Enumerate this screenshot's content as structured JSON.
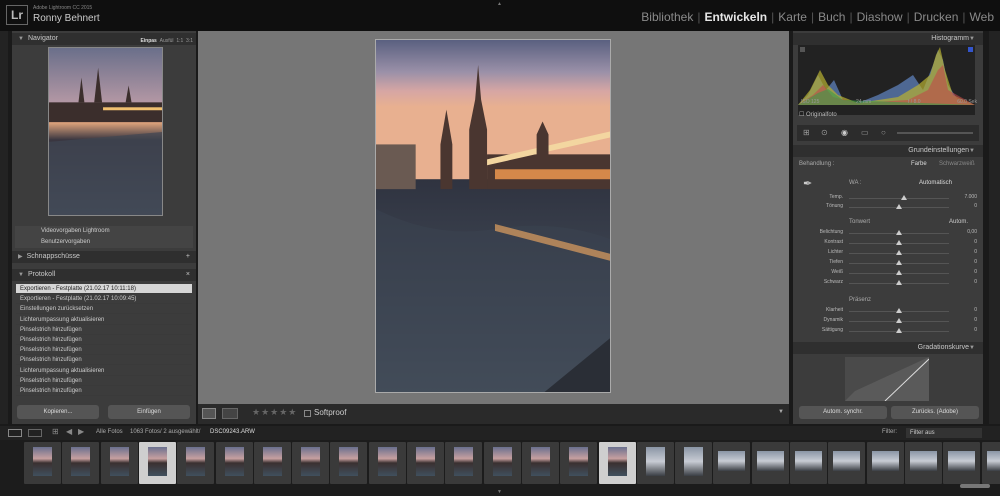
{
  "app": {
    "name": "Adobe Lightroom CC 2015",
    "user": "Ronny Behnert",
    "logo": "Lr"
  },
  "modules": [
    {
      "label": "Bibliothek",
      "active": false
    },
    {
      "label": "Entwickeln",
      "active": true
    },
    {
      "label": "Karte",
      "active": false
    },
    {
      "label": "Buch",
      "active": false
    },
    {
      "label": "Diashow",
      "active": false
    },
    {
      "label": "Drucken",
      "active": false
    },
    {
      "label": "Web",
      "active": false
    }
  ],
  "left": {
    "navigator_title": "Navigator",
    "navigator_opts": [
      "Einpas",
      "Ausfül",
      "1:1",
      "3:1"
    ],
    "tree_items": [
      "Videovorgaben Lightroom",
      "Benutzervorgaben"
    ],
    "snapshots_title": "Schnappschüsse",
    "history_title": "Protokoll",
    "history_items": [
      "Exportieren - Festplatte (21.02.17 10:11:18)",
      "Exportieren - Festplatte (21.02.17 10:09:45)",
      "Einstellungen zurücksetzen",
      "Lichterumpassung aktualisieren",
      "Pinselstrich hinzufügen",
      "Pinselstrich hinzufügen",
      "Pinselstrich hinzufügen",
      "Pinselstrich hinzufügen",
      "Lichterumpassung aktualisieren",
      "Pinselstrich hinzufügen",
      "Pinselstrich hinzufügen"
    ],
    "copy_button": "Kopieren...",
    "paste_button": "Einfügen"
  },
  "toolbar": {
    "softproof": "Softproof"
  },
  "right": {
    "histogram_title": "Histogramm",
    "hist_info": [
      "ISO 125",
      "24 mm",
      "f / 8.0",
      "60.0 Sek"
    ],
    "original_photo": "Originalfoto",
    "basic_title": "Grundeinstellungen",
    "treatment_label": "Behandlung :",
    "color_label": "Farbe",
    "bw_label": "Schwarzweiß",
    "wb_label": "WA :",
    "wb_value": "Automatisch",
    "temp_sliders": [
      {
        "label": "Temp.",
        "value": "7.000",
        "pos": 0.55
      },
      {
        "label": "Tönung",
        "value": "0",
        "pos": 0.5
      }
    ],
    "tone_label": "Tonwert",
    "auto_label": "Autom.",
    "tone_sliders": [
      {
        "label": "Belichtung",
        "value": "0,00",
        "pos": 0.5
      },
      {
        "label": "Kontrast",
        "value": "0",
        "pos": 0.5
      },
      {
        "label": "Lichter",
        "value": "0",
        "pos": 0.5
      },
      {
        "label": "Tiefen",
        "value": "0",
        "pos": 0.5
      },
      {
        "label": "Weiß",
        "value": "0",
        "pos": 0.5
      },
      {
        "label": "Schwarz",
        "value": "0",
        "pos": 0.5
      }
    ],
    "presence_label": "Präsenz",
    "presence_sliders": [
      {
        "label": "Klarheit",
        "value": "0",
        "pos": 0.5
      },
      {
        "label": "Dynamik",
        "value": "0",
        "pos": 0.5
      },
      {
        "label": "Sättigung",
        "value": "0",
        "pos": 0.5
      }
    ],
    "curve_title": "Gradationskurve",
    "sync_button": "Autom. synchr.",
    "reset_button": "Zurücks. (Adobe)"
  },
  "filmbar": {
    "all_photos": "Alle Fotos",
    "count": "1063 Fotos/ 2 ausgewählt/",
    "filename": "DSC09243.ARW",
    "filter_label": "Filter:",
    "filter_value": "Filter aus"
  },
  "filmstrip": {
    "count": 26,
    "selected": [
      3,
      15
    ]
  }
}
